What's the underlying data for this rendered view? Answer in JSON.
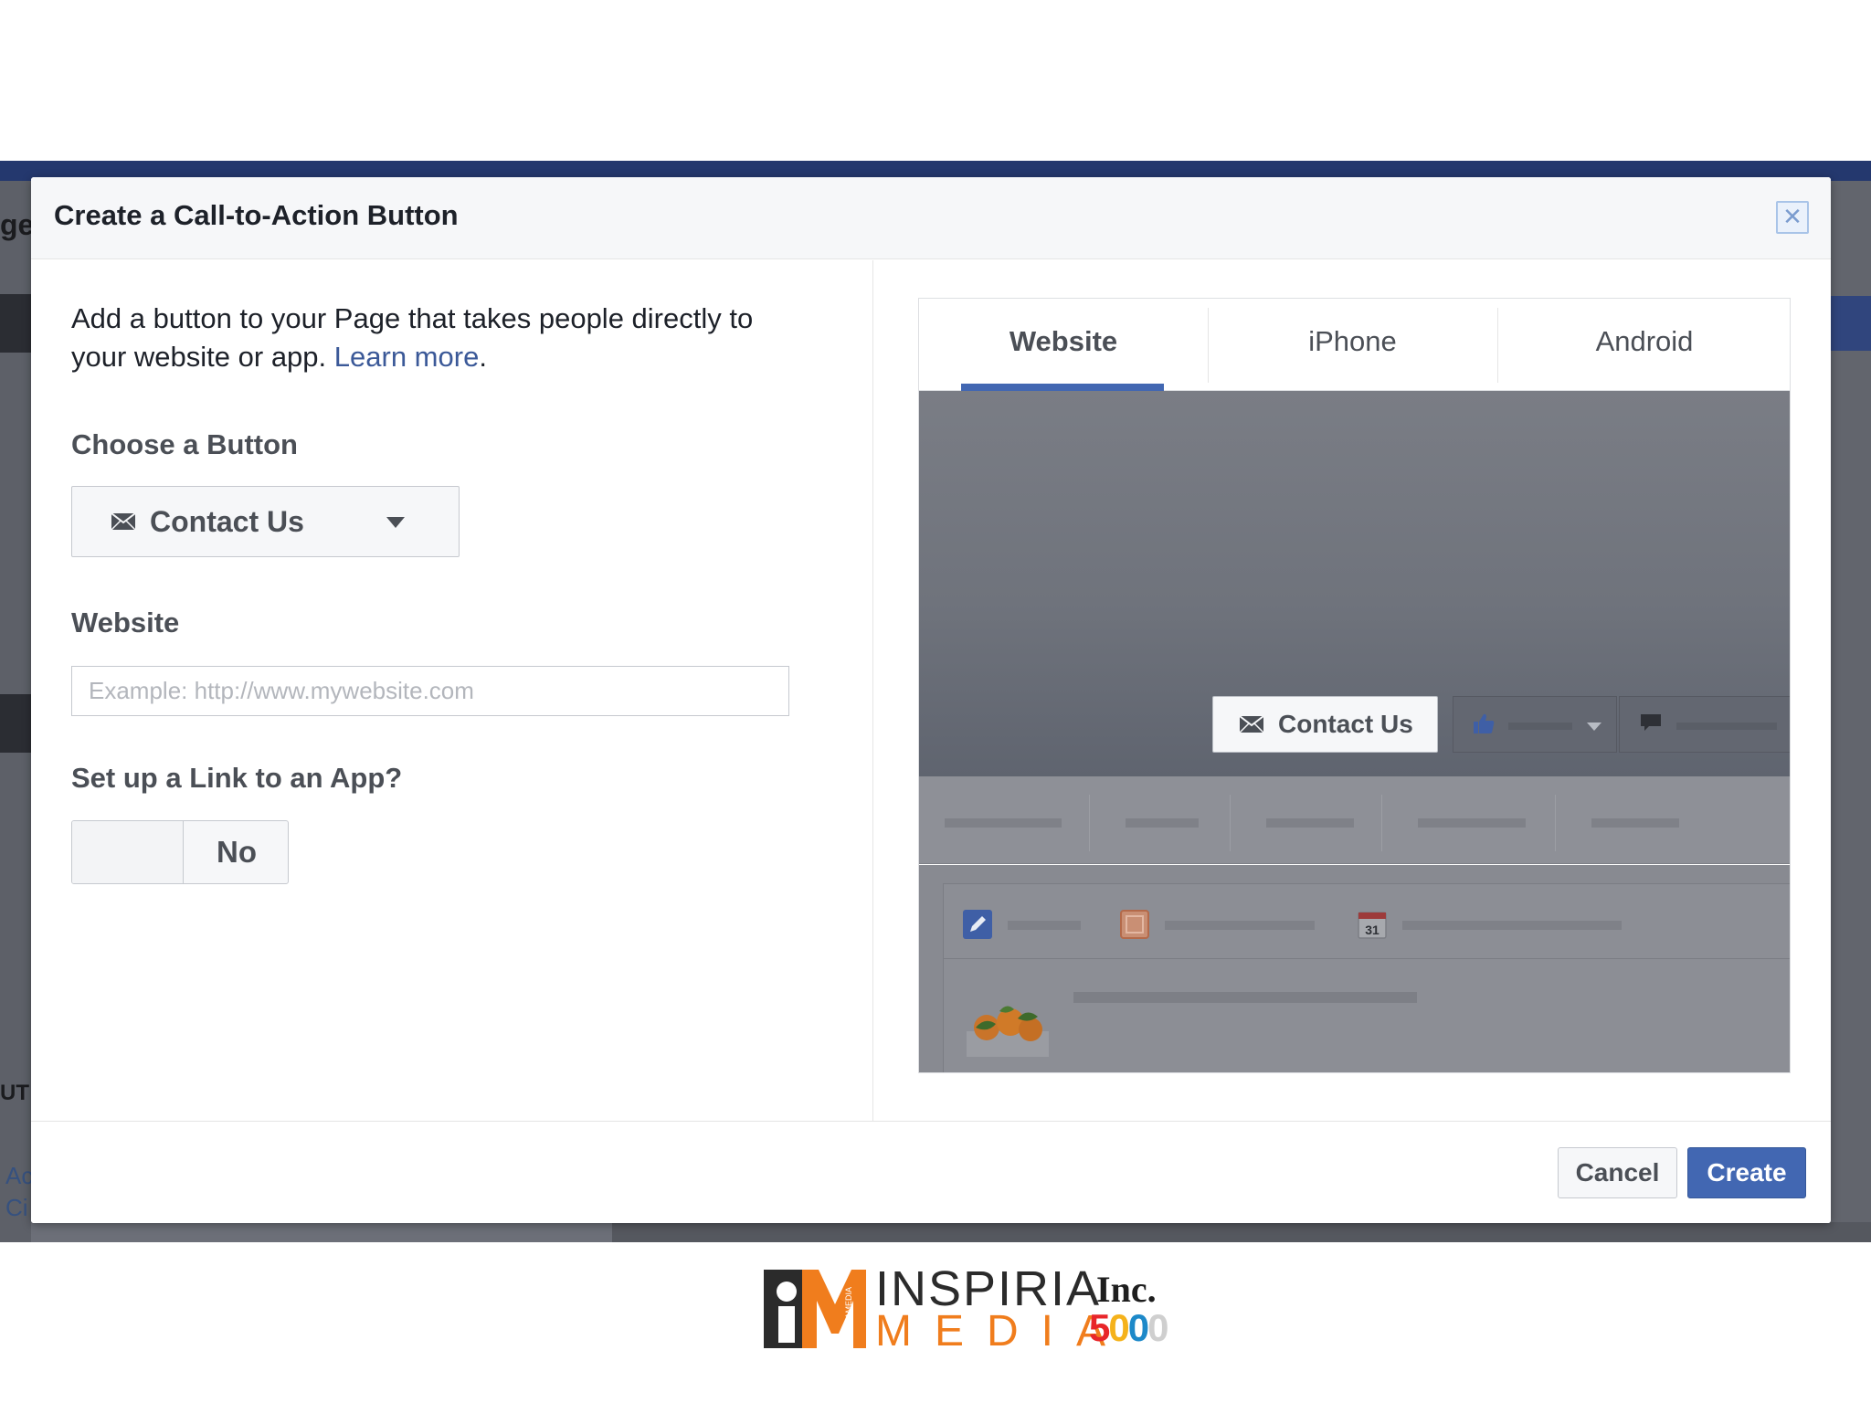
{
  "dialog": {
    "title": "Create a Call-to-Action Button",
    "close_icon": "close-icon"
  },
  "left": {
    "description": "Add a button to your Page that takes people directly to your website or app.",
    "learn_more": "Learn more",
    "choose_label": "Choose a Button",
    "selected_button": "Contact Us",
    "website_label": "Website",
    "website_placeholder": "Example: http://www.mywebsite.com",
    "website_value": "",
    "app_link_label": "Set up a Link to an App?",
    "app_link_value": "No"
  },
  "preview": {
    "tabs": [
      {
        "label": "Website",
        "active": true
      },
      {
        "label": "iPhone",
        "active": false
      },
      {
        "label": "Android",
        "active": false
      }
    ],
    "cover_button_label": "Contact Us",
    "calendar_day": "31"
  },
  "footer": {
    "cancel_label": "Cancel",
    "create_label": "Create"
  },
  "background_fragments": [
    "ge",
    "UT",
    "Ac",
    "Ci"
  ],
  "brand": {
    "name_top": "INSPIRIA",
    "name_bottom": "MEDIA",
    "mark_text": "INSPIRIAMEDIA",
    "inc": "Inc.",
    "inc_number_digits": [
      "5",
      "0",
      "0",
      "0"
    ]
  },
  "colors": {
    "fb_blue": "#4267b2",
    "link_blue": "#3b5998",
    "brand_orange": "#f07d1d"
  }
}
